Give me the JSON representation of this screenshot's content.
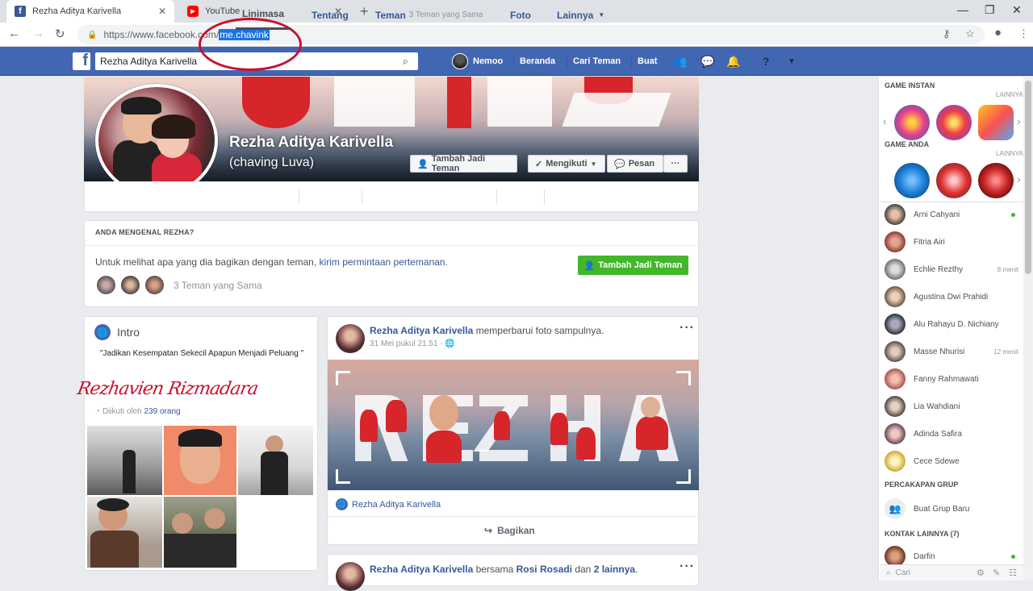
{
  "browser": {
    "tabs": [
      {
        "title": "Rezha Aditya Karivella"
      },
      {
        "title": "YouTube"
      }
    ],
    "url_prefix": "https://www.facebook.com/",
    "url_selected": "me.chavink",
    "new_tab": "+"
  },
  "fb": {
    "search_value": "Rezha Aditya Karivella",
    "nav": {
      "user": "Nemoo",
      "home": "Beranda",
      "find_friends": "Cari Teman",
      "create": "Buat"
    }
  },
  "profile": {
    "name": "Rezha Aditya Karivella",
    "alt_name": "(chaving Luva)",
    "add_friend": "Tambah Jadi Teman",
    "following": "Mengikuti",
    "message": "Pesan",
    "more": "···",
    "tabs": [
      {
        "label": "Linimasa"
      },
      {
        "label": "Tentang"
      },
      {
        "label": "Teman",
        "sub": "3 Teman yang Sama"
      },
      {
        "label": "Foto"
      },
      {
        "label": "Lainnya"
      }
    ]
  },
  "know": {
    "title": "ANDA MENGENAL REZHA?",
    "text_a": "Untuk melihat apa yang dia bagikan dengan teman, ",
    "link": "kirim permintaan pertemanan.",
    "button": "Tambah Jadi Teman",
    "mutual": "3 Teman yang Sama"
  },
  "intro": {
    "title": "Intro",
    "quote": "\"Jadikan Kesempatan Sekecil Apapun Menjadi Peluang \"",
    "signature": "Rezhavien Rizmadara",
    "followed_prefix": "Diikuti oleh ",
    "followed_count": "239 orang"
  },
  "post": {
    "author": "Rezha Aditya Karivella",
    "action": " memperbarui foto sampulnya.",
    "date": "31 Mei pukul 21.51 · ",
    "dots": "···",
    "page": "Rezha Aditya Karivella",
    "share": "Bagikan",
    "image_text": "REZHA"
  },
  "post2": {
    "author": "Rezha Aditya Karivella",
    "mid": " bersama ",
    "with": "Rosi Rosadi",
    "and": " dan ",
    "others": "2 lainnya",
    "tail": "."
  },
  "sidebar": {
    "instant_games": "GAME INSTAN",
    "more1": "LAINNYA",
    "your_games": "GAME ANDA",
    "more2": "LAINNYA",
    "contacts": [
      {
        "name": "Arni Cahyani",
        "time": "",
        "online": true
      },
      {
        "name": "Fitria Airi",
        "time": "",
        "online": false
      },
      {
        "name": "Echlie Rezthy",
        "time": "8 menit",
        "online": false
      },
      {
        "name": "Agustina Dwi Prahidi",
        "time": "",
        "online": false
      },
      {
        "name": "Alu Rahayu D. Nichiany",
        "time": "",
        "online": false
      },
      {
        "name": "Masse Nhurisi",
        "time": "12 menit",
        "online": false
      },
      {
        "name": "Fanny Rahmawati",
        "time": "",
        "online": false
      },
      {
        "name": "Lia Wahdiani",
        "time": "",
        "online": false
      },
      {
        "name": "Adinda Safira",
        "time": "",
        "online": false
      },
      {
        "name": "Cece Sdewe",
        "time": "",
        "online": false
      }
    ],
    "group_convos": "PERCAKAPAN GRUP",
    "create_group": "Buat Grup Baru",
    "other_contacts": "KONTAK LAINNYA (7)",
    "other_contact": "Darfin",
    "search_placeholder": "Cari"
  },
  "colors": {
    "fb_blue": "#4267b2",
    "link_blue": "#365899",
    "green": "#42b72a",
    "annotation_red": "#c8102e"
  }
}
